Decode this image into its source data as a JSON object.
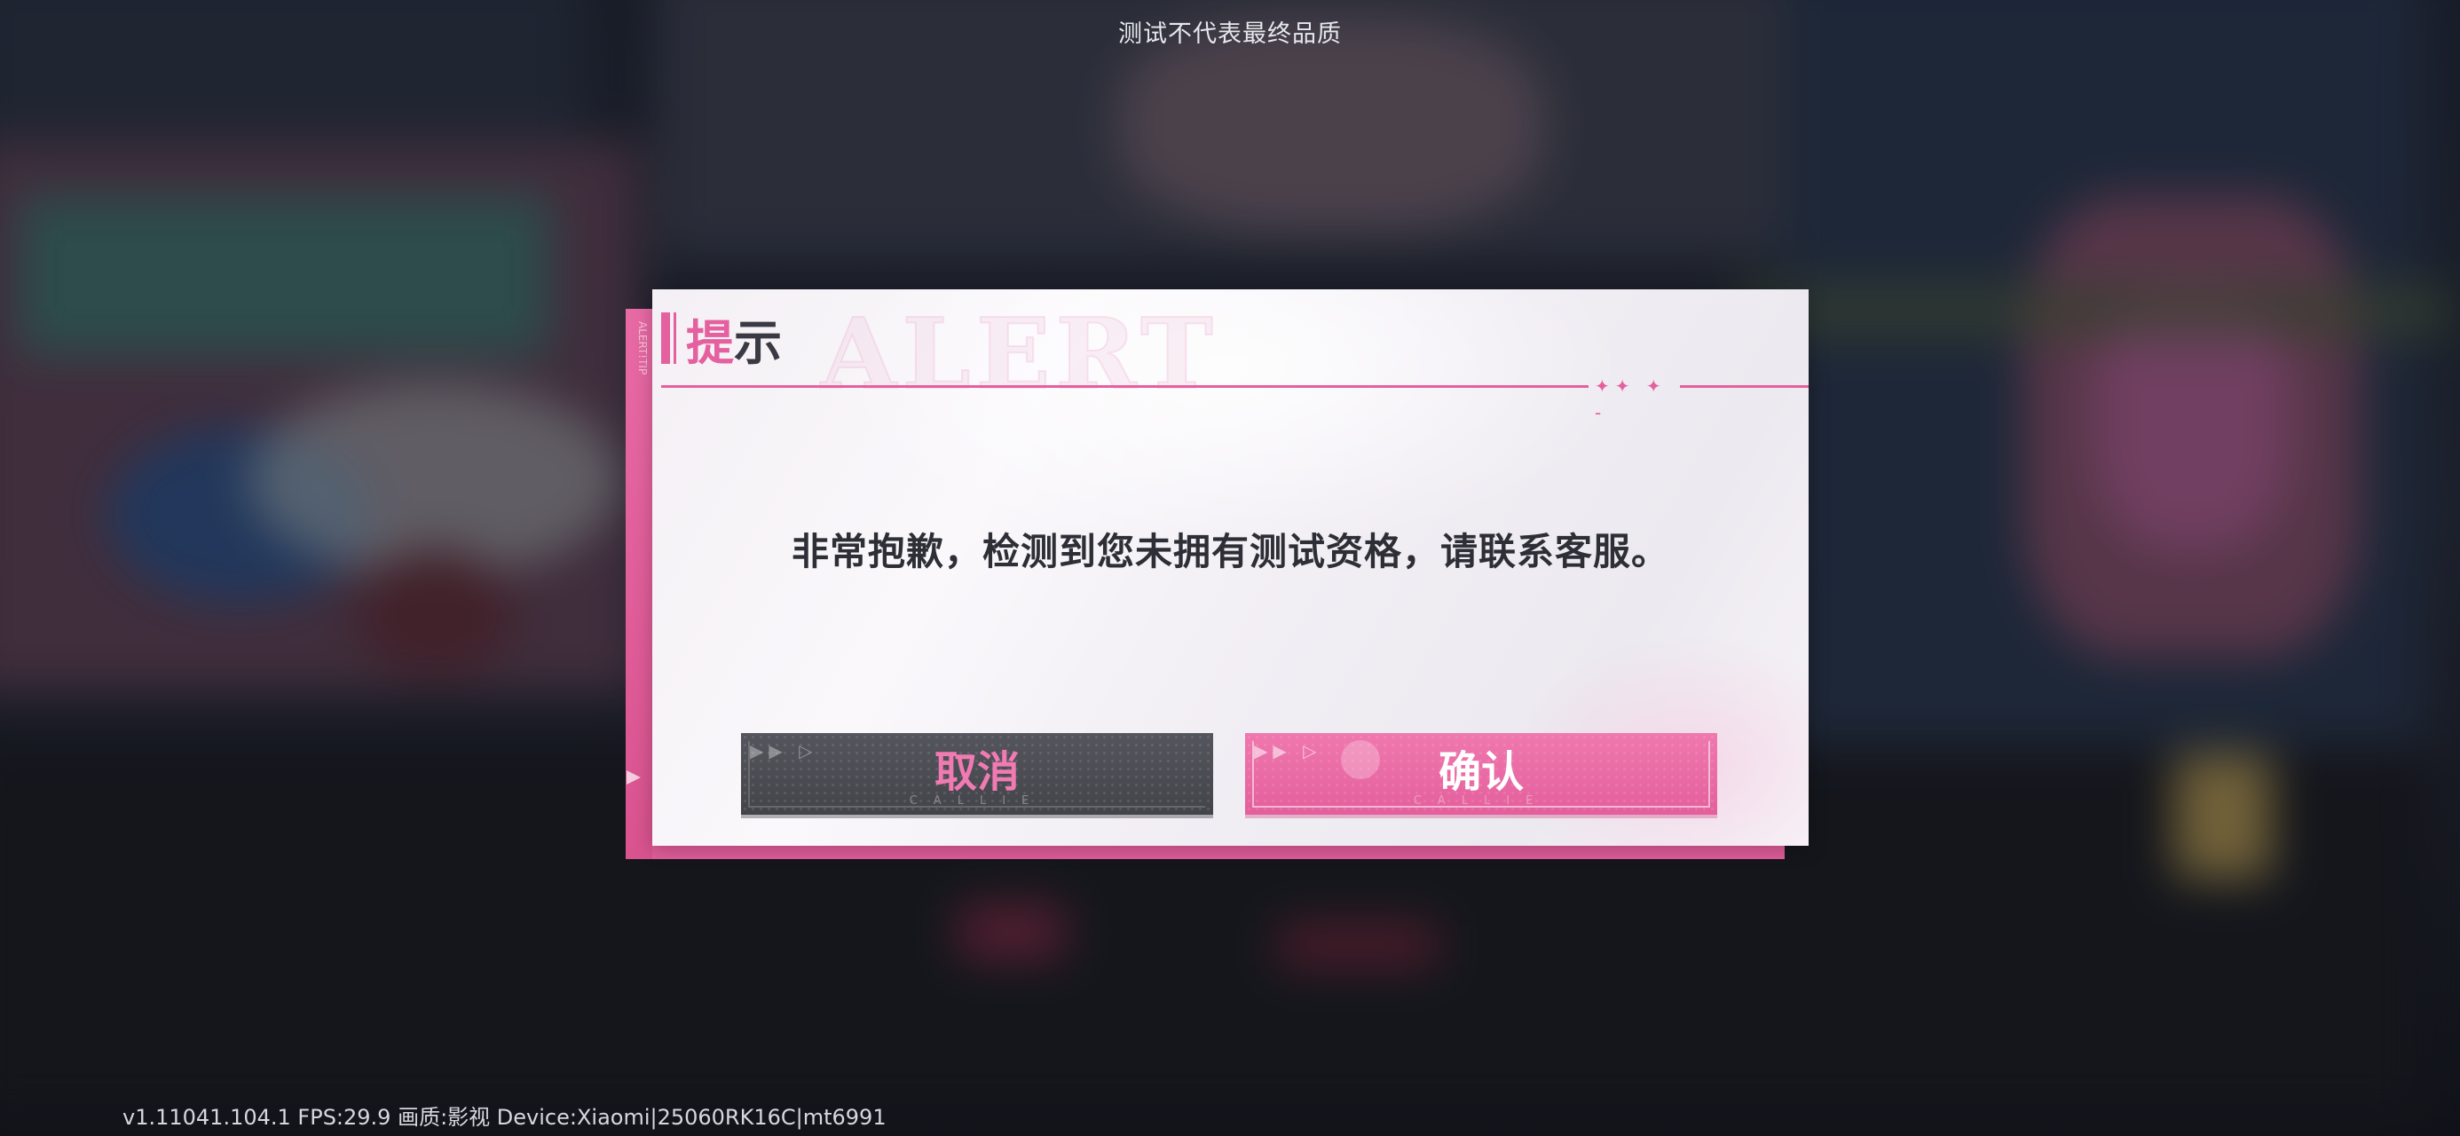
{
  "top_notice": "测试不代表最终品质",
  "dialog": {
    "watermark": "ALERT",
    "title_first": "提",
    "title_rest": "示",
    "title_deco": "✦✦ ✦ -",
    "side_text": "ALERT!TIP",
    "message": "非常抱歉，检测到您未拥有测试资格，请联系客服。",
    "buttons": {
      "cancel_label": "取消",
      "confirm_label": "确认",
      "sub_text": "CALLIE",
      "arrows": "▶▶ ▷"
    }
  },
  "status_bar": {
    "text": "v1.11041.104.1 FPS:29.9 画质:影视 Device:Xiaomi|25060RK16C|mt6991"
  },
  "colors": {
    "accent": "#e4609e",
    "cancel_bg": "#48484f",
    "confirm_bg": "#e8669f"
  }
}
